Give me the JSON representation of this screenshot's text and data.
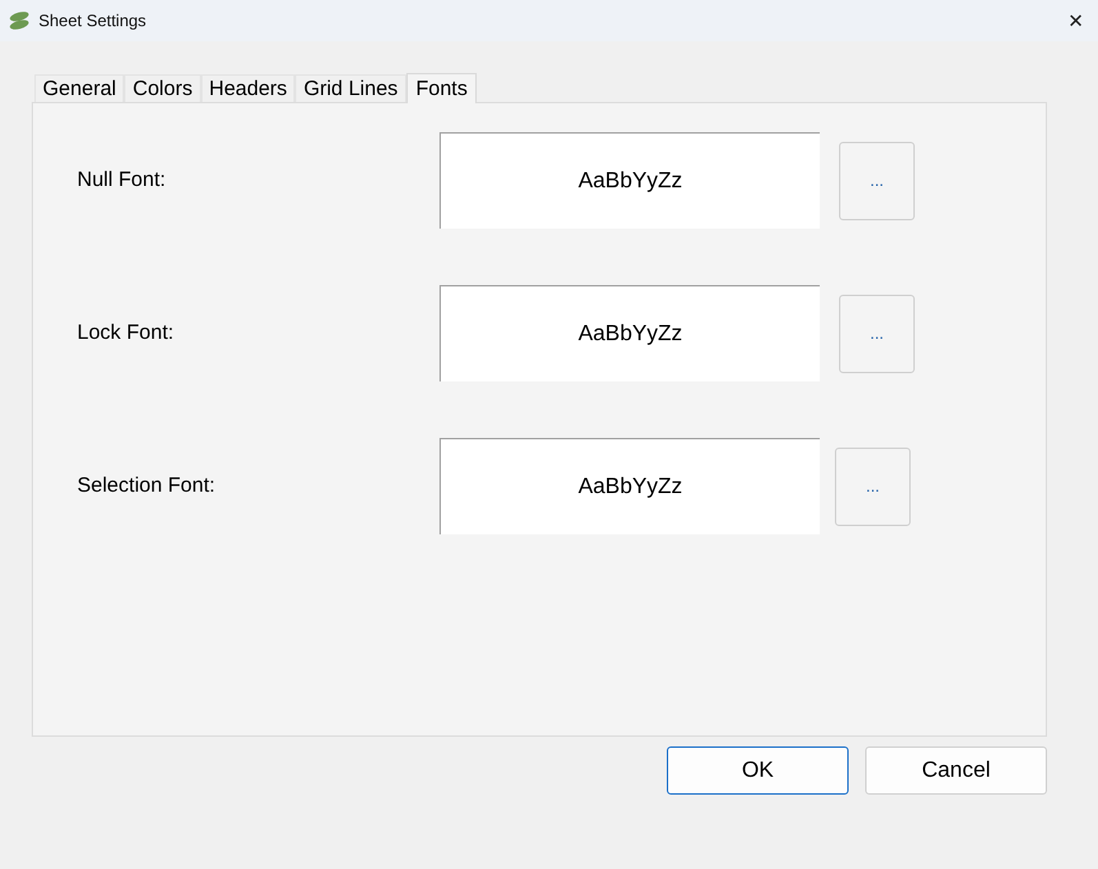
{
  "window": {
    "title": "Sheet Settings",
    "close": "✕"
  },
  "tabs": [
    {
      "label": "General",
      "selected": false
    },
    {
      "label": "Colors",
      "selected": false
    },
    {
      "label": "Headers",
      "selected": false
    },
    {
      "label": "Grid Lines",
      "selected": false
    },
    {
      "label": "Fonts",
      "selected": true
    }
  ],
  "fonts": [
    {
      "label": "Null Font:",
      "preview": "AaBbYyZz",
      "button": "..."
    },
    {
      "label": "Lock Font:",
      "preview": "AaBbYyZz",
      "button": "..."
    },
    {
      "label": "Selection Font:",
      "preview": "AaBbYyZz",
      "button": "..."
    }
  ],
  "buttons": [
    {
      "label": "OK",
      "default": true
    },
    {
      "label": "Cancel",
      "default": false
    }
  ]
}
